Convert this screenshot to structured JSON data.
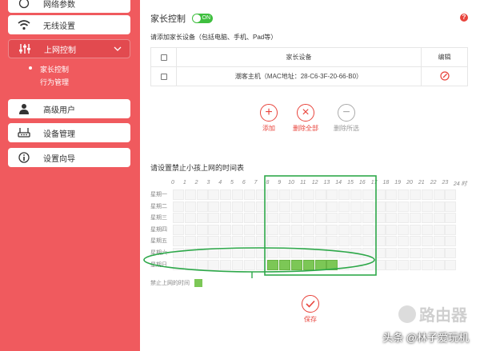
{
  "sidebar": {
    "items": [
      {
        "label": "网络参数",
        "icon": "globe-icon"
      },
      {
        "label": "无线设置",
        "icon": "wifi-icon"
      },
      {
        "label": "上网控制",
        "icon": "sliders-icon"
      },
      {
        "label": "高级用户",
        "icon": "user-icon"
      },
      {
        "label": "设备管理",
        "icon": "router-icon"
      },
      {
        "label": "设置向导",
        "icon": "info-icon"
      }
    ],
    "submenu": [
      {
        "label": "家长控制",
        "selected": true
      },
      {
        "label": "行为管理",
        "selected": false
      }
    ]
  },
  "main": {
    "title": "家长控制",
    "toggle_label": "ON",
    "help": "?",
    "hint": "请添加家长设备（包括电脑、手机、Pad等）",
    "table": {
      "headers": [
        "",
        "家长设备",
        "编辑"
      ],
      "rows": [
        {
          "device": "潮客主机（MAC地址：28-C6-3F-20-66-B0）"
        }
      ]
    },
    "actions": [
      {
        "label": "添加",
        "icon": "plus-icon"
      },
      {
        "label": "删除全部",
        "icon": "x-icon"
      },
      {
        "label": "删除所选",
        "icon": "minus-icon"
      }
    ],
    "schedule_title": "请设置禁止小孩上网的时间表",
    "hours": [
      "0",
      "1",
      "2",
      "3",
      "4",
      "5",
      "6",
      "7",
      "8",
      "9",
      "10",
      "11",
      "12",
      "13",
      "14",
      "15",
      "16",
      "17",
      "18",
      "19",
      "20",
      "21",
      "22",
      "23",
      "24 时"
    ],
    "days": [
      "星期一",
      "星期二",
      "星期三",
      "星期四",
      "星期五",
      "星期六",
      "星期日"
    ],
    "blocked": {
      "day_index": 6,
      "from_hour": 8,
      "to_hour": 14
    },
    "legend": "禁止上网的时间",
    "save_label": "保存",
    "accent_color": "#f05a5e",
    "blocked_color": "#7cc756"
  },
  "watermarks": {
    "brand": "路由器",
    "source": "头条 @林子爱玩机"
  }
}
